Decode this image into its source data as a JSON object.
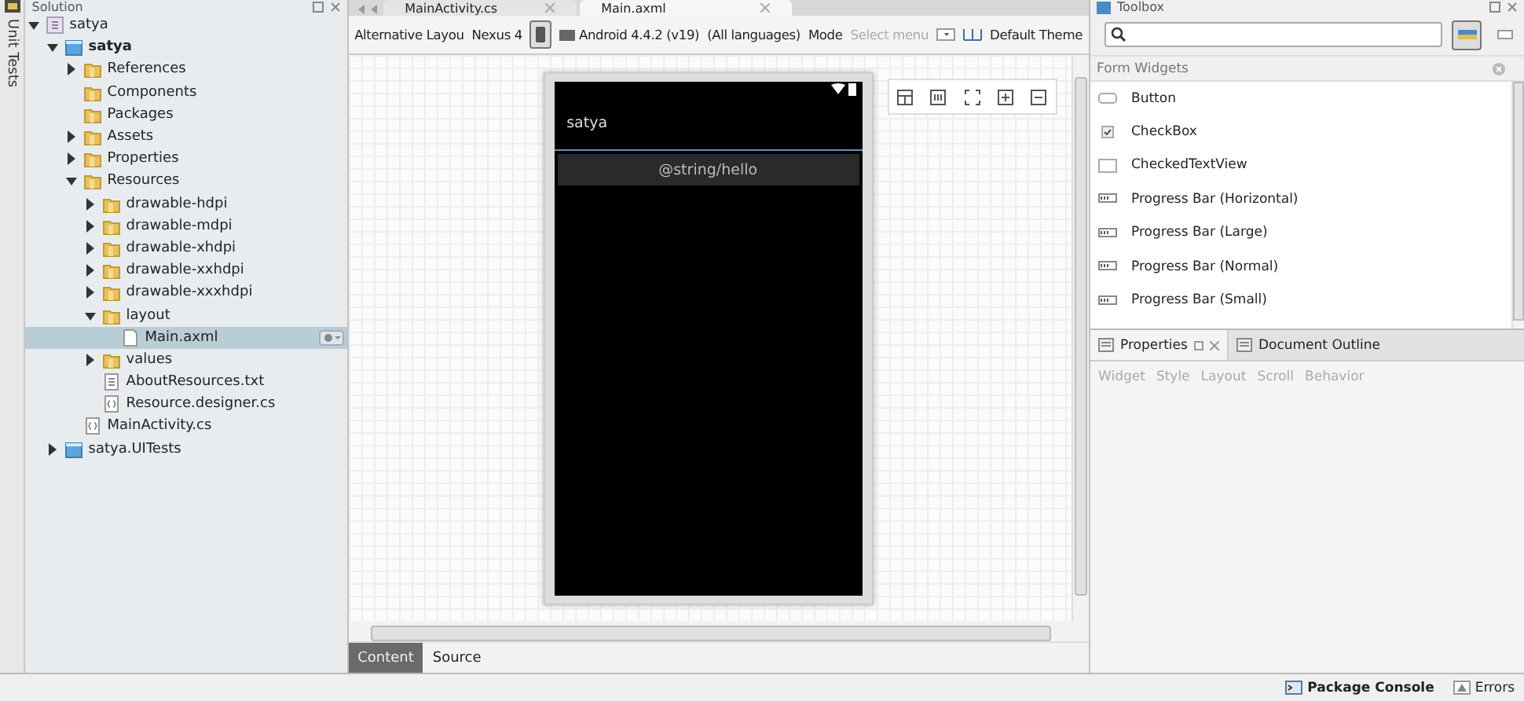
{
  "side_strip": {
    "label": "Unit Tests"
  },
  "solution": {
    "title": "Solution",
    "tree": [
      {
        "label": "satya",
        "kind": "solution",
        "expanded": true,
        "selected": false,
        "children": [
          {
            "label": "satya",
            "kind": "project",
            "bold": true,
            "expanded": true,
            "selected": false,
            "children": [
              {
                "label": "References",
                "kind": "folder",
                "expanded": false,
                "selected": false
              },
              {
                "label": "Components",
                "kind": "folder",
                "selected": false
              },
              {
                "label": "Packages",
                "kind": "folder",
                "selected": false
              },
              {
                "label": "Assets",
                "kind": "folder",
                "expanded": false,
                "selected": false
              },
              {
                "label": "Properties",
                "kind": "folder",
                "expanded": false,
                "selected": false
              },
              {
                "label": "Resources",
                "kind": "folder",
                "expanded": true,
                "selected": false,
                "children": [
                  {
                    "label": "drawable-hdpi",
                    "kind": "folder",
                    "expanded": false,
                    "selected": false
                  },
                  {
                    "label": "drawable-mdpi",
                    "kind": "folder",
                    "expanded": false,
                    "selected": false
                  },
                  {
                    "label": "drawable-xhdpi",
                    "kind": "folder",
                    "expanded": false,
                    "selected": false
                  },
                  {
                    "label": "drawable-xxhdpi",
                    "kind": "folder",
                    "expanded": false,
                    "selected": false
                  },
                  {
                    "label": "drawable-xxxhdpi",
                    "kind": "folder",
                    "expanded": false,
                    "selected": false
                  },
                  {
                    "label": "layout",
                    "kind": "folder",
                    "expanded": true,
                    "selected": false,
                    "children": [
                      {
                        "label": "Main.axml",
                        "kind": "file",
                        "selected": true
                      }
                    ]
                  },
                  {
                    "label": "values",
                    "kind": "folder",
                    "expanded": false,
                    "selected": false
                  },
                  {
                    "label": "AboutResources.txt",
                    "kind": "text",
                    "selected": false
                  },
                  {
                    "label": "Resource.designer.cs",
                    "kind": "code",
                    "selected": false
                  }
                ]
              },
              {
                "label": "MainActivity.cs",
                "kind": "code",
                "selected": false
              }
            ]
          },
          {
            "label": "satya.UITests",
            "kind": "project",
            "expanded": false,
            "selected": false
          }
        ]
      }
    ]
  },
  "editor": {
    "tabs": [
      {
        "label": "MainActivity.cs",
        "selected": false
      },
      {
        "label": "Main.axml",
        "selected": true
      }
    ],
    "toolbar": {
      "layout": "Alternative Layou",
      "device": "Nexus 4",
      "api": "Android 4.4.2 (v19)",
      "language": "(All languages)",
      "mode_label": "Mode",
      "mode_placeholder": "Select menu",
      "theme": "Default Theme"
    },
    "phone": {
      "app_title": "satya",
      "button_text": "@string/hello"
    },
    "bottom_tabs": [
      {
        "label": "Content",
        "selected": true
      },
      {
        "label": "Source",
        "selected": false
      }
    ]
  },
  "toolbox": {
    "title": "Toolbox",
    "category": "Form Widgets",
    "items": [
      {
        "label": "Button",
        "kind": "button"
      },
      {
        "label": "CheckBox",
        "kind": "checkbox"
      },
      {
        "label": "CheckedTextView",
        "kind": "checked-text"
      },
      {
        "label": "Progress Bar (Horizontal)",
        "kind": "progress"
      },
      {
        "label": "Progress Bar (Large)",
        "kind": "progress"
      },
      {
        "label": "Progress Bar (Normal)",
        "kind": "progress"
      },
      {
        "label": "Progress Bar (Small)",
        "kind": "progress"
      }
    ]
  },
  "properties": {
    "tabs": [
      {
        "label": "Properties",
        "selected": true
      },
      {
        "label": "Document Outline",
        "selected": false
      }
    ],
    "sections": [
      {
        "label": "Widget",
        "disabled": true
      },
      {
        "label": "Style",
        "disabled": true
      },
      {
        "label": "Layout",
        "disabled": true
      },
      {
        "label": "Scroll",
        "disabled": true
      },
      {
        "label": "Behavior",
        "disabled": true
      }
    ]
  },
  "status_bar": [
    {
      "label": "Package Console",
      "kind": "console"
    },
    {
      "label": "Errors",
      "kind": "errors"
    }
  ]
}
